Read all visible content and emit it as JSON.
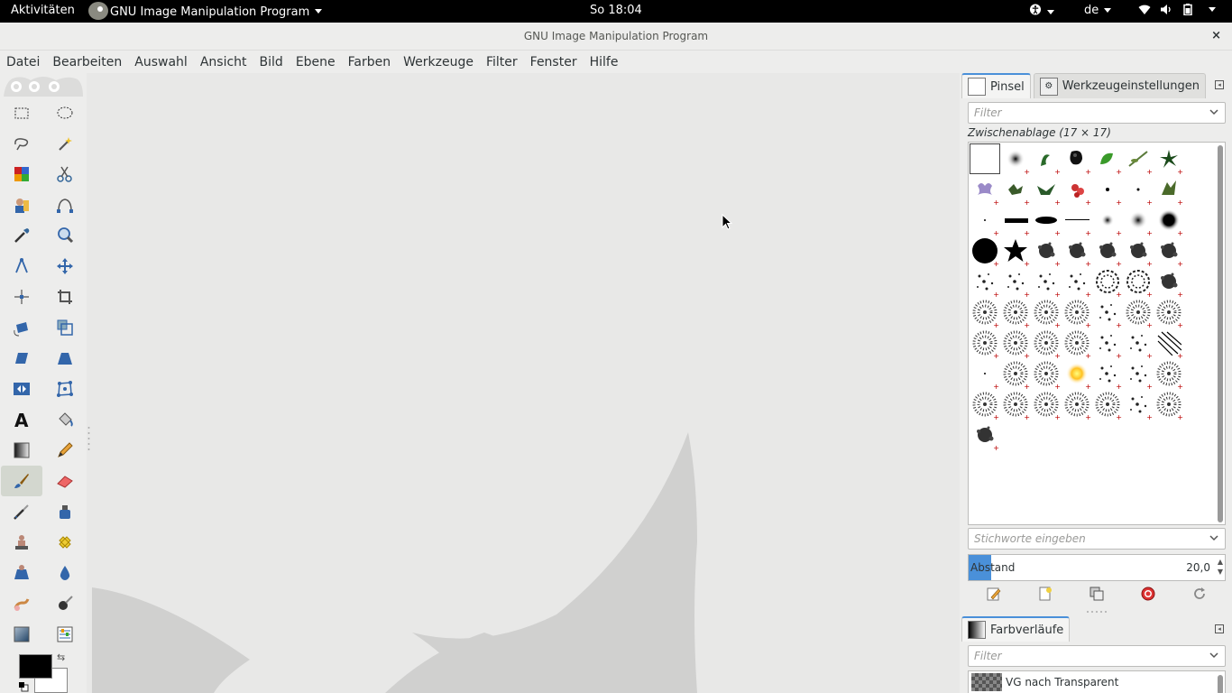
{
  "topbar": {
    "activities": "Aktivitäten",
    "app_menu": "GNU Image Manipulation Program",
    "clock": "So 18:04",
    "language": "de",
    "icons": [
      "accessibility-icon",
      "wifi-icon",
      "volume-icon",
      "battery-icon",
      "power-menu-icon"
    ]
  },
  "window": {
    "title": "GNU Image Manipulation Program",
    "close": "×"
  },
  "menubar": {
    "items": [
      "Datei",
      "Bearbeiten",
      "Auswahl",
      "Ansicht",
      "Bild",
      "Ebene",
      "Farben",
      "Werkzeuge",
      "Filter",
      "Fenster",
      "Hilfe"
    ]
  },
  "toolbox": {
    "tools": [
      "rect-select-icon",
      "ellipse-select-icon",
      "free-select-icon",
      "fuzzy-select-icon",
      "color-select-icon",
      "scissors-select-icon",
      "foreground-select-icon",
      "paths-icon",
      "color-picker-icon",
      "zoom-icon",
      "measure-icon",
      "move-icon",
      "align-icon",
      "crop-icon",
      "rotate-icon",
      "scale-icon",
      "shear-icon",
      "perspective-icon",
      "flip-icon",
      "cage-transform-icon",
      "text-icon",
      "bucket-fill-icon",
      "blend-icon",
      "pencil-icon",
      "paintbrush-icon",
      "eraser-icon",
      "airbrush-icon",
      "ink-icon",
      "clone-icon",
      "heal-icon",
      "perspective-clone-icon",
      "blur-sharpen-icon",
      "smudge-icon",
      "dodge-burn-icon",
      "threshold-icon",
      "levels-icon"
    ],
    "active_tool": "paintbrush-icon",
    "foreground": "#000000",
    "background": "#ffffff"
  },
  "brushes_dock": {
    "tabs": [
      "Pinsel",
      "Werkzeugeinstellungen"
    ],
    "filter_placeholder": "Filter",
    "brush_name": "Zwischenablage (17 × 17)",
    "tags_placeholder": "Stichworte eingeben",
    "spacing_label": "Abstand",
    "spacing_value": "20,0",
    "spacing_fraction": 0.2,
    "brush_count": 60,
    "actions": [
      "edit-brush-icon",
      "new-brush-icon",
      "duplicate-brush-icon",
      "delete-brush-icon",
      "refresh-brushes-icon"
    ]
  },
  "gradients_dock": {
    "tab": "Farbverläufe",
    "filter_placeholder": "Filter",
    "first_gradient": "VG nach Transparent"
  },
  "colors": {
    "accent": "#4a90d9",
    "canvas_bg": "#e8e8e7",
    "wilber_watermark": "#d0d0cf"
  }
}
